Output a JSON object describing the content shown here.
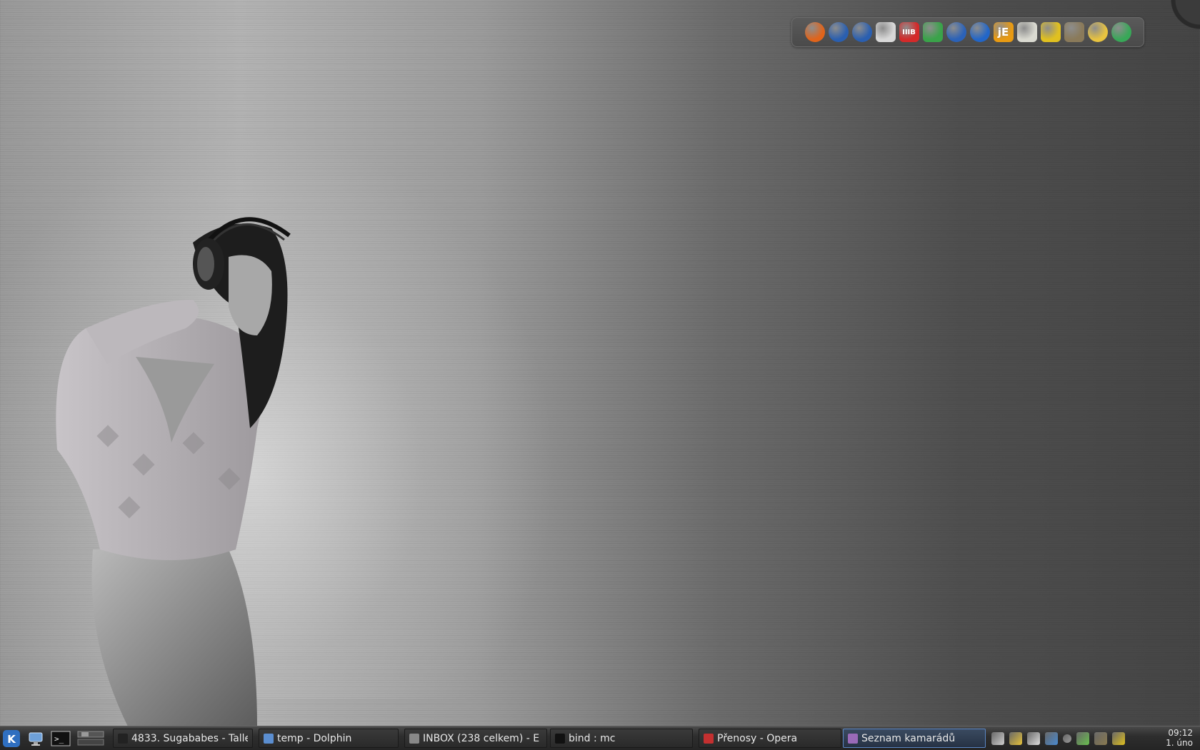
{
  "dock": {
    "icons": [
      {
        "name": "firefox-icon",
        "glyph": "",
        "bg": "#e0641b"
      },
      {
        "name": "globe-network-icon",
        "glyph": "",
        "bg": "#2a5fb0"
      },
      {
        "name": "globe-network-2-icon",
        "glyph": "",
        "bg": "#2a5fb0"
      },
      {
        "name": "mail-envelope-icon",
        "glyph": "",
        "bg": "#d8d8d8"
      },
      {
        "name": "calendar-iiib-icon",
        "glyph": "IIIB",
        "bg": "#d42a2a"
      },
      {
        "name": "download-icon",
        "glyph": "",
        "bg": "#3aa34a"
      },
      {
        "name": "bird-client-icon",
        "glyph": "",
        "bg": "#2b62b8"
      },
      {
        "name": "opera-icon",
        "glyph": "",
        "bg": "#2266c8"
      },
      {
        "name": "java-editor-icon",
        "glyph": "jE",
        "bg": "#e89a12"
      },
      {
        "name": "lightbulb-icon",
        "glyph": "",
        "bg": "#d9d9d0"
      },
      {
        "name": "office-suite-icon",
        "glyph": "",
        "bg": "#e0c020"
      },
      {
        "name": "gimp-icon",
        "glyph": "",
        "bg": "#8a7a5a"
      },
      {
        "name": "compass-icon",
        "glyph": "",
        "bg": "#e8c340"
      },
      {
        "name": "music-player-icon",
        "glyph": "",
        "bg": "#38a858"
      }
    ]
  },
  "taskbar": {
    "tasks": [
      {
        "name": "task-music-player",
        "label": "4833. Sugababes - Talle",
        "icon_color": "#222"
      },
      {
        "name": "task-dolphin",
        "label": "temp - Dolphin",
        "icon_color": "#5b8ed0"
      },
      {
        "name": "task-mail-inbox",
        "label": "INBOX (238 celkem) - E",
        "icon_color": "#888"
      },
      {
        "name": "task-terminal-mc",
        "label": "bind : mc",
        "icon_color": "#111"
      },
      {
        "name": "task-opera-transfers",
        "label": "Přenosy - Opera",
        "icon_color": "#c43030"
      },
      {
        "name": "task-contact-list",
        "label": "Seznam kamarádů",
        "icon_color": "#9a6ab8"
      }
    ],
    "clock": {
      "time": "09:12",
      "date": "1. úno"
    },
    "tray_icon_colors": [
      "#cfcfcf",
      "#e6c23a",
      "#e0e0e0",
      "#4a8ad0",
      "#9a9a9a",
      "#6ac050",
      "#8a7a50",
      "#e0c020"
    ]
  }
}
